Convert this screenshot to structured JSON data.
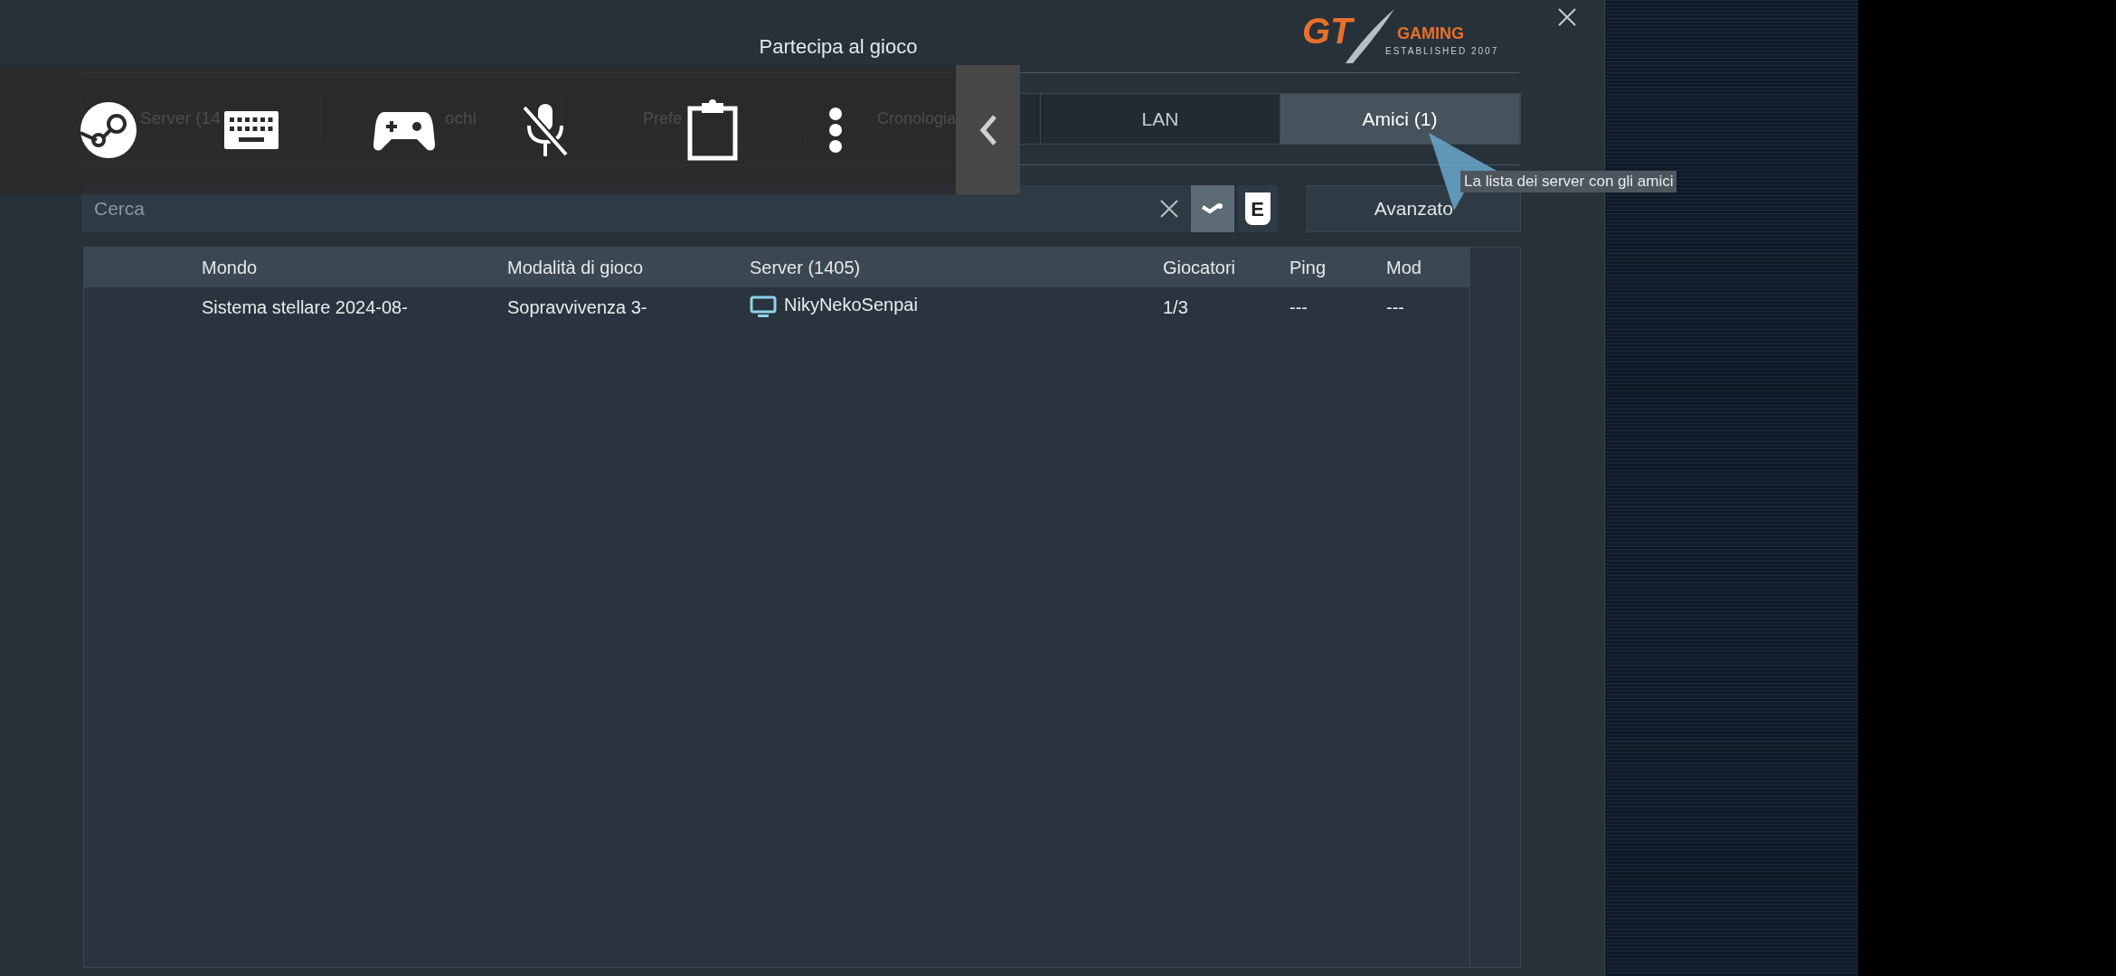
{
  "window": {
    "title": "Partecipa al gioco"
  },
  "logo": {
    "main": "GT",
    "sub": "GAMING",
    "tagline": "ESTABLISHED 2007"
  },
  "tabs": [
    {
      "label": "Server (14",
      "selected": false
    },
    {
      "label": "ochi",
      "selected": false
    },
    {
      "label": "Prefe",
      "selected": false
    },
    {
      "label": "Cronologia",
      "selected": false
    },
    {
      "label": "LAN",
      "selected": false
    },
    {
      "label": "Amici (1)",
      "selected": true
    }
  ],
  "tooltip": "La lista dei server con gli amici",
  "search": {
    "placeholder": "Cerca",
    "steam_filter": true,
    "epic_label": "E"
  },
  "advanced_button": "Avanzato",
  "table": {
    "columns": [
      "Mondo",
      "Modalità di gioco",
      "Server (1405)",
      "Giocatori",
      "Ping",
      "Mod"
    ],
    "rows": [
      {
        "world": "Sistema stellare 2024-08-",
        "mode": "Sopravvivenza 3-",
        "server": "NikyNekoSenpai",
        "players": "1/3",
        "ping": "---",
        "mod": "---"
      }
    ]
  }
}
